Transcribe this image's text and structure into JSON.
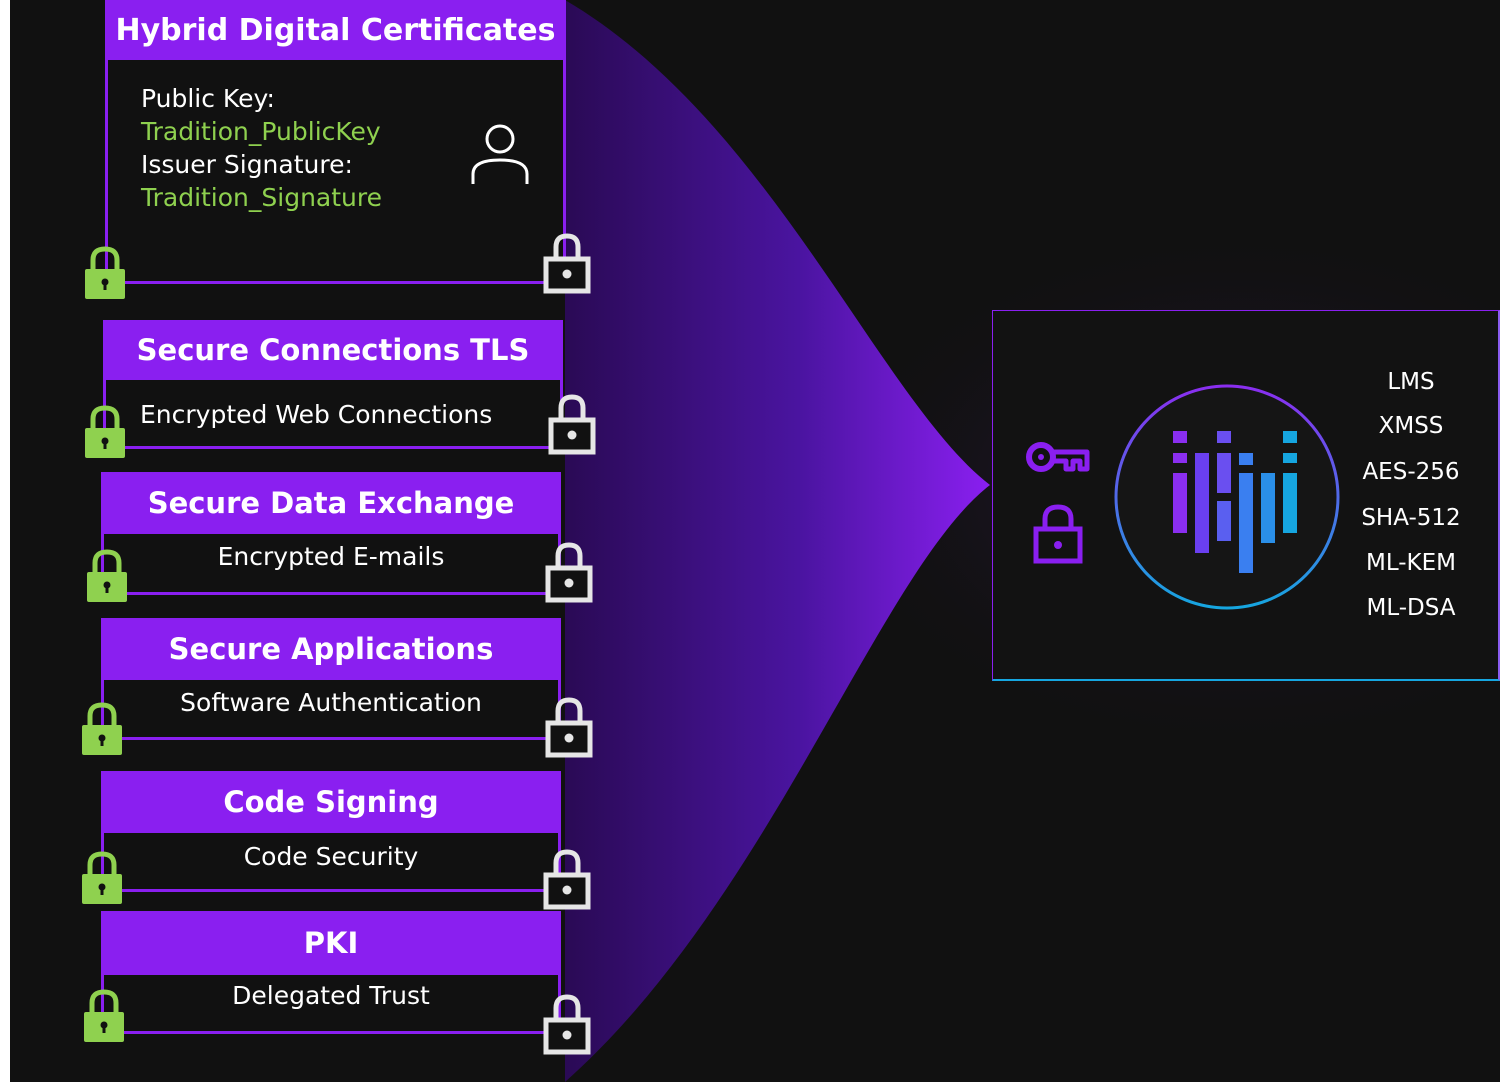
{
  "cert": {
    "title": "Hybrid Digital Certificates",
    "public_key_label": "Public Key:",
    "public_key_value": "Tradition_PublicKey",
    "issuer_label": "Issuer Signature:",
    "issuer_value": "Tradition_Signature"
  },
  "panels": [
    {
      "title": "Secure Connections TLS",
      "subtitle": "Encrypted Web Connections"
    },
    {
      "title": "Secure Data Exchange",
      "subtitle": "Encrypted E-mails"
    },
    {
      "title": "Secure Applications",
      "subtitle": "Software Authentication"
    },
    {
      "title": "Code Signing",
      "subtitle": "Code Security"
    },
    {
      "title": "PKI",
      "subtitle": "Delegated Trust"
    }
  ],
  "algorithms": [
    "LMS",
    "XMSS",
    "AES-256",
    "SHA-512",
    "ML-KEM",
    "ML-DSA"
  ],
  "colors": {
    "purple": "#8a1ff0",
    "green": "#8fd14f",
    "background": "#111111",
    "blue": "#16a6e0"
  },
  "icons": {
    "left_lock": "green-padlock-icon",
    "right_lock": "white-padlock-icon",
    "user": "user-icon",
    "key": "key-icon",
    "logo": "bar-logo-icon"
  }
}
